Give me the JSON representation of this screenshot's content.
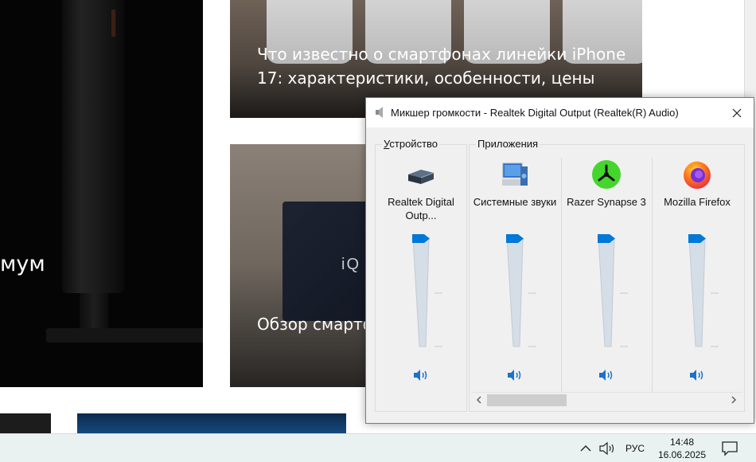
{
  "background_site": {
    "card_left_title": "мум",
    "card_top_title": "Что известно о смартфонах линейки iPhone 17: характеристики, особенности, цены",
    "card_mid_title": "Обзор смартф производител",
    "card_mid_brand": "iQ"
  },
  "mixer": {
    "title": "Микшер громкости - Realtek Digital Output (Realtek(R) Audio)",
    "close_icon": "close-icon",
    "device_group_label_accel": "У",
    "device_group_label_rest": "стройство",
    "apps_group_label": "Приложения",
    "device": {
      "name": "Realtek Digital Outp...",
      "icon": "speaker-device-icon",
      "level": 1.0
    },
    "apps": [
      {
        "name": "Системные звуки",
        "icon": "system-sounds-icon",
        "level": 1.0
      },
      {
        "name": "Razer Synapse 3",
        "icon": "razer-icon",
        "level": 1.0
      },
      {
        "name": "Mozilla Firefox",
        "icon": "firefox-icon",
        "level": 1.0
      }
    ],
    "mute_icon": "speaker-volume-icon",
    "colors": {
      "accent": "#0078d7",
      "track": "#d5dde6",
      "razer": "#44d62c"
    }
  },
  "taskbar": {
    "language": "РУС",
    "time": "14:48",
    "date": "16.06.2025",
    "icons": [
      "chevron-up-icon",
      "volume-icon",
      "notification-icon"
    ]
  }
}
